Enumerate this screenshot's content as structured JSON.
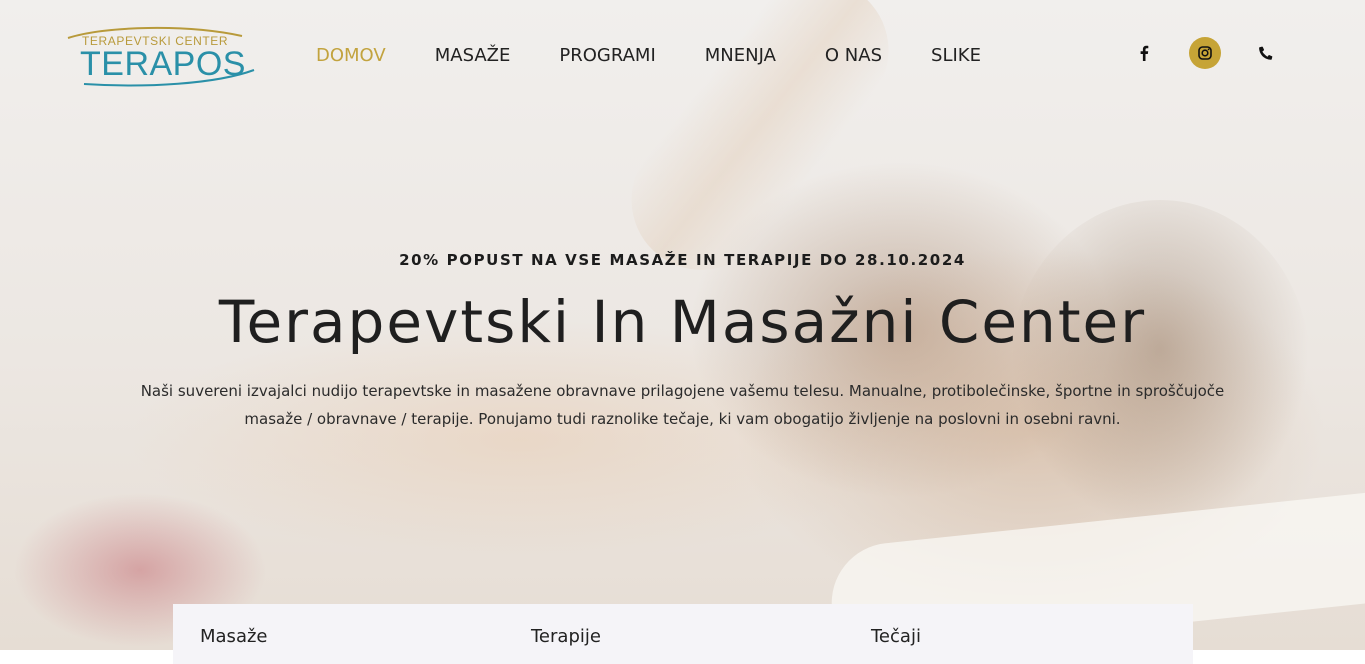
{
  "brand": {
    "logo_top": "TERAPEVTSKI CENTER",
    "logo_main": "TERAPOS",
    "gold": "#c2a33e",
    "teal": "#2a90a8"
  },
  "nav": {
    "items": [
      {
        "label": "DOMOV",
        "active": true
      },
      {
        "label": "MASAŽE"
      },
      {
        "label": "PROGRAMI"
      },
      {
        "label": "MNENJA"
      },
      {
        "label": "O NAS"
      },
      {
        "label": "SLIKE"
      }
    ]
  },
  "social": {
    "facebook_icon": "facebook-icon",
    "instagram_icon": "instagram-icon",
    "phone_icon": "phone-icon",
    "accent": "#c6a436"
  },
  "hero": {
    "promo": "20% POPUST NA VSE MASAŽE IN TERAPIJE DO 28.10.2024",
    "headline": "Terapevtski In Masažni Center",
    "desc_line1": "Naši suvereni izvajalci nudijo terapevtske in masažene obravnave prilagojene vašemu telesu. Manualne, protibolečinske, športne in sproščujoče",
    "desc_line2": "masaže / obravnave / terapije. Ponujamo tudi raznolike tečaje, ki vam obogatijo življenje na poslovni in osebni ravni."
  },
  "cards": [
    {
      "title": "Masaže"
    },
    {
      "title": "Terapije"
    },
    {
      "title": "Tečaji"
    }
  ]
}
